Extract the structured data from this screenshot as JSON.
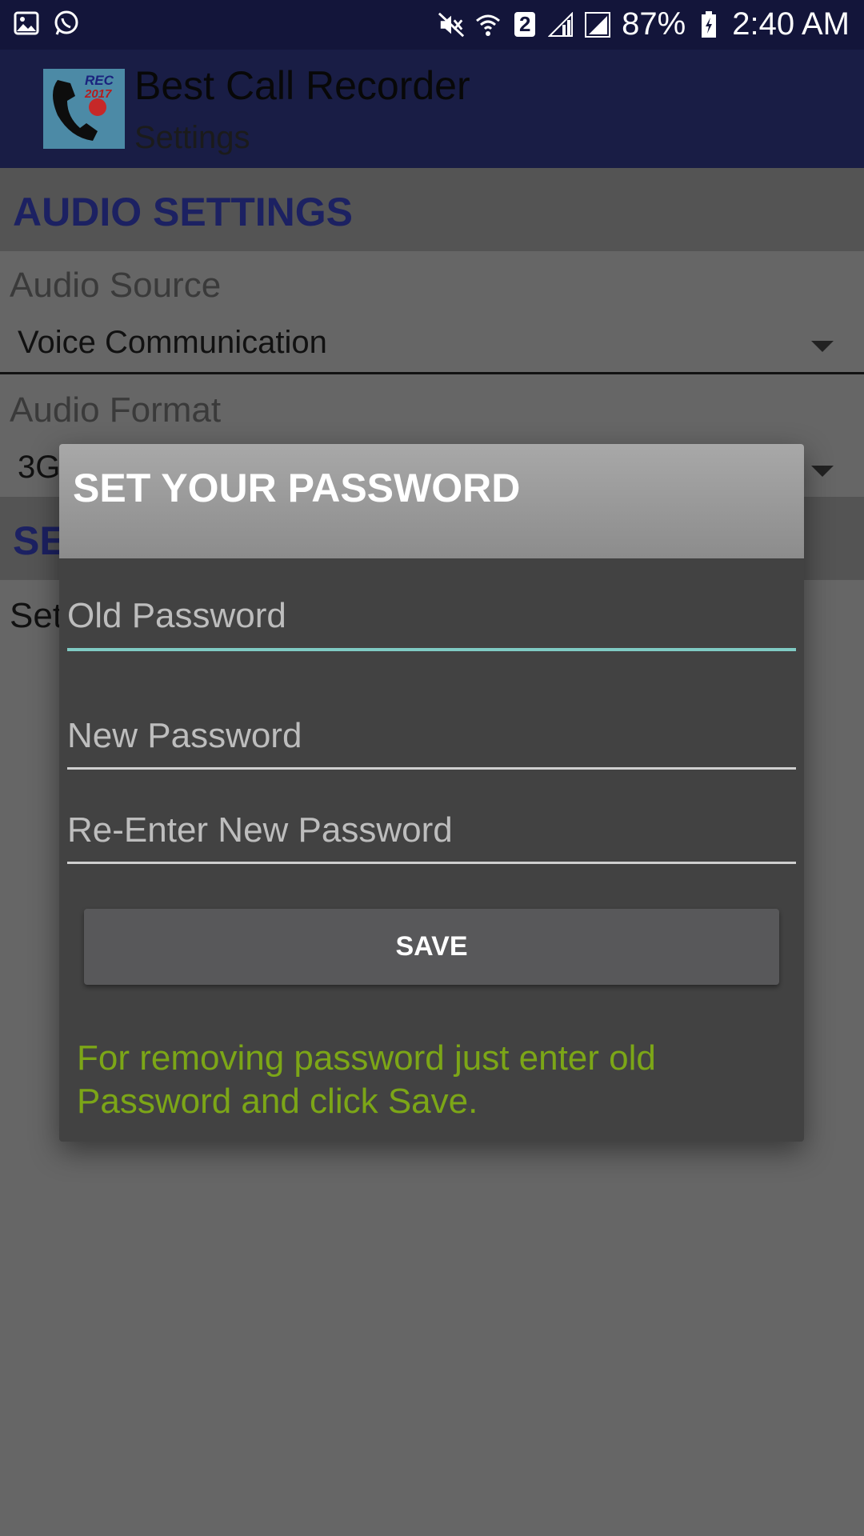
{
  "status_bar": {
    "battery": "87%",
    "time": "2:40 AM",
    "sim_badge": "2",
    "icons": [
      "image-icon",
      "whatsapp-icon",
      "mute-icon",
      "wifi-icon",
      "signal-icon",
      "battery-charging-icon"
    ]
  },
  "app_bar": {
    "title": "Best Call Recorder",
    "subtitle": "Settings",
    "icon_text_top": "REC",
    "icon_text_bottom": "2017"
  },
  "settings": {
    "audio_section_title": "AUDIO SETTINGS",
    "audio_source_label": "Audio Source",
    "audio_source_value": "Voice Communication",
    "audio_format_label": "Audio Format",
    "audio_format_value": "3G",
    "second_section_title": "SE",
    "second_item_label": "Set"
  },
  "dialog": {
    "title": "SET YOUR PASSWORD",
    "old_password_placeholder": "Old Password",
    "new_password_placeholder": "New Password",
    "reenter_password_placeholder": "Re-Enter New Password",
    "save_label": "SAVE",
    "hint": "For removing password just enter old Password and click Save."
  },
  "colors": {
    "status_bar": "#13153a",
    "app_bar": "#191d45",
    "section_title": "#1c2162",
    "field_focus": "#80cbc4",
    "hint_text": "#7ca617"
  }
}
